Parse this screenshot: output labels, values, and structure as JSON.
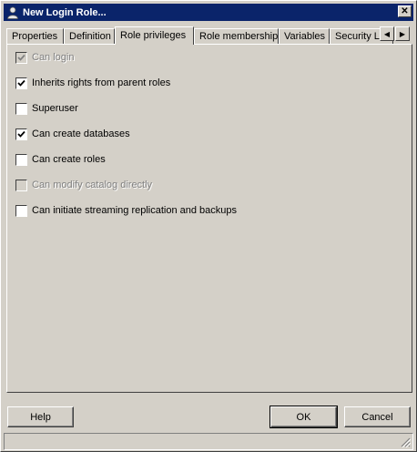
{
  "window": {
    "title": "New Login Role..."
  },
  "tabs": [
    {
      "label": "Properties"
    },
    {
      "label": "Definition"
    },
    {
      "label": "Role privileges"
    },
    {
      "label": "Role membership"
    },
    {
      "label": "Variables"
    },
    {
      "label": "Security Lab"
    }
  ],
  "active_tab": "Role privileges",
  "privileges": [
    {
      "label": "Can login",
      "checked": true,
      "enabled": false
    },
    {
      "label": "Inherits rights from parent roles",
      "checked": true,
      "enabled": true
    },
    {
      "label": "Superuser",
      "checked": false,
      "enabled": true
    },
    {
      "label": "Can create databases",
      "checked": true,
      "enabled": true
    },
    {
      "label": "Can create roles",
      "checked": false,
      "enabled": true
    },
    {
      "label": "Can modify catalog directly",
      "checked": false,
      "enabled": false
    },
    {
      "label": "Can initiate streaming replication and backups",
      "checked": false,
      "enabled": true
    }
  ],
  "buttons": {
    "help": "Help",
    "ok": "OK",
    "cancel": "Cancel"
  },
  "icons": {
    "title": "user-icon",
    "close": "close-icon"
  }
}
